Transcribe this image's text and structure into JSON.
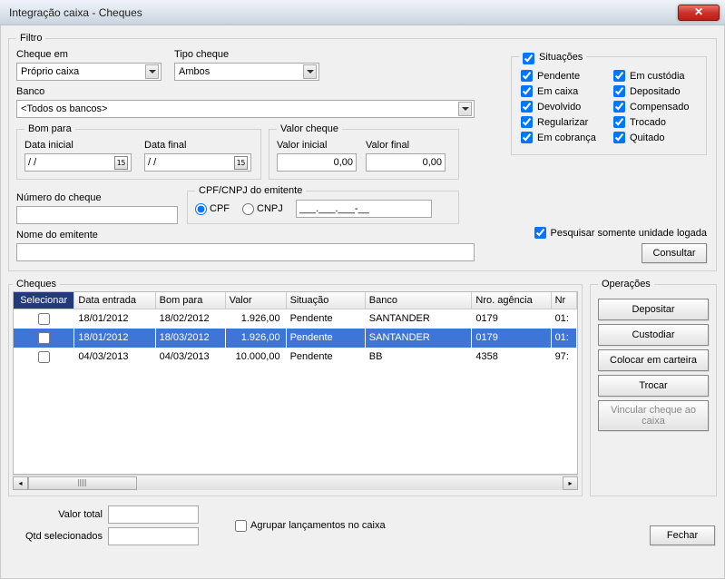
{
  "title": "Integração caixa - Cheques",
  "filter": {
    "legend": "Filtro",
    "cheque_em_label": "Cheque em",
    "cheque_em_value": "Próprio caixa",
    "tipo_cheque_label": "Tipo cheque",
    "tipo_cheque_value": "Ambos",
    "banco_label": "Banco",
    "banco_value": "<Todos os bancos>",
    "bom_para_legend": "Bom para",
    "data_inicial_label": "Data inicial",
    "data_inicial_value": "  /  /",
    "data_final_label": "Data final",
    "data_final_value": "  /  /",
    "valor_cheque_legend": "Valor cheque",
    "valor_inicial_label": "Valor inicial",
    "valor_inicial_value": "0,00",
    "valor_final_label": "Valor final",
    "valor_final_value": "0,00",
    "numero_cheque_label": "Número do cheque",
    "cpf_cnpj_legend": "CPF/CNPJ do emitente",
    "cpf_label": "CPF",
    "cnpj_label": "CNPJ",
    "cpf_cnpj_mask": "___.___.___-__",
    "nome_emitente_label": "Nome do emitente",
    "consultar": "Consultar"
  },
  "situacoes": {
    "legend": "Situações",
    "items": [
      "Pendente",
      "Em custódia",
      "Em caixa",
      "Depositado",
      "Devolvido",
      "Compensado",
      "Regularizar",
      "Trocado",
      "Em cobrança",
      "Quitado"
    ]
  },
  "pesquisar_unidade": "Pesquisar somente unidade logada",
  "cheques": {
    "legend": "Cheques",
    "columns": [
      "Selecionar",
      "Data entrada",
      "Bom para",
      "Valor",
      "Situação",
      "Banco",
      "Nro. agência",
      "Nr"
    ],
    "rows": [
      {
        "sel": false,
        "data_entrada": "18/01/2012",
        "bom_para": "18/02/2012",
        "valor": "1.926,00",
        "situacao": "Pendente",
        "banco": "SANTANDER",
        "agencia": "0179",
        "nr": "01:"
      },
      {
        "sel": false,
        "data_entrada": "18/01/2012",
        "bom_para": "18/03/2012",
        "valor": "1.926,00",
        "situacao": "Pendente",
        "banco": "SANTANDER",
        "agencia": "0179",
        "nr": "01:"
      },
      {
        "sel": false,
        "data_entrada": "04/03/2013",
        "bom_para": "04/03/2013",
        "valor": "10.000,00",
        "situacao": "Pendente",
        "banco": "BB",
        "agencia": "4358",
        "nr": "97:"
      }
    ],
    "selected_index": 1
  },
  "operacoes": {
    "legend": "Operações",
    "depositar": "Depositar",
    "custodiar": "Custodiar",
    "colocar_carteira": "Colocar em carteira",
    "trocar": "Trocar",
    "vincular": "Vincular cheque ao caixa"
  },
  "bottom": {
    "valor_total_label": "Valor total",
    "valor_total_value": "",
    "qtd_sel_label": "Qtd selecionados",
    "qtd_sel_value": "",
    "agrupar_label": "Agrupar lançamentos no caixa",
    "fechar": "Fechar"
  }
}
